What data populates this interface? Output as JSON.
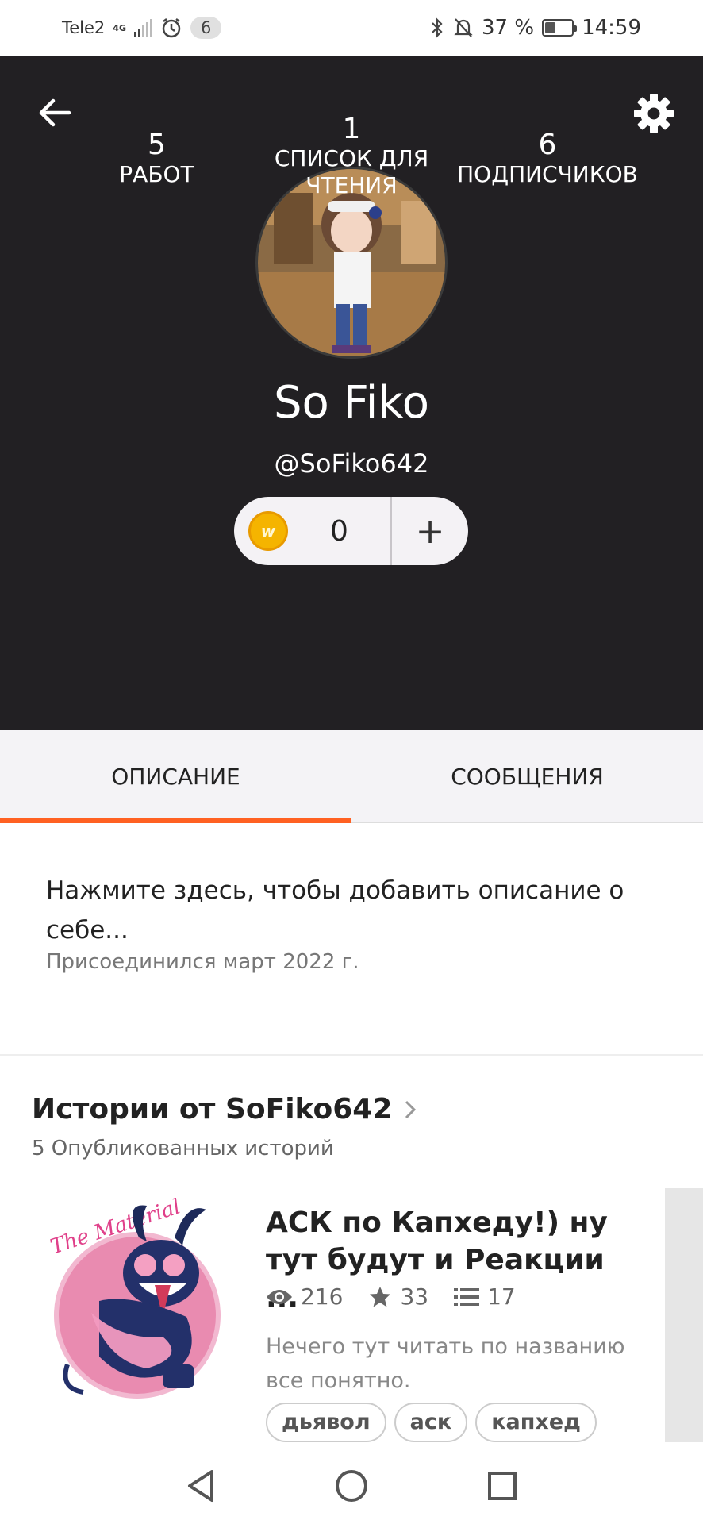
{
  "status_bar": {
    "carrier": "Tele2",
    "network": "4G",
    "notification_count": "6",
    "battery": "37 %",
    "time": "14:59",
    "icons": [
      "signal-icon",
      "alarm-icon",
      "bluetooth-icon",
      "mute-icon",
      "battery-icon"
    ]
  },
  "header": {
    "back_icon": "arrow-left-icon",
    "settings_icon": "gear-icon",
    "display_name": "So Fiko",
    "username": "@SoFiko642",
    "coins": {
      "count": "0",
      "add_label": "+"
    },
    "stats": {
      "works_count": "5",
      "works_label": "РАБОТ",
      "reading_count": "1",
      "reading_label_1": "СПИСОК ДЛЯ",
      "reading_label_2": "ЧТЕНИЯ",
      "followers_count": "6",
      "followers_label": "ПОДПИСЧИКОВ"
    }
  },
  "tabs": [
    {
      "label": "ОПИСАНИЕ",
      "active": true
    },
    {
      "label": "СООБЩЕНИЯ",
      "active": false
    }
  ],
  "about": {
    "prompt": "Нажмите здесь, чтобы добавить описание о себе...",
    "joined": "Присоединился март 2022 г."
  },
  "stories": {
    "title": "Истории от SoFiko642",
    "subtitle": "5 Опубликованных историй",
    "items": [
      {
        "title": "АСК по Капхеду!) ну тут будут и Реакции ...",
        "views": "216",
        "votes": "33",
        "parts": "17",
        "description": "Нечего тут читать по названию все понятно.",
        "tags": [
          "дьявол",
          "аск",
          "капхед"
        ]
      }
    ]
  },
  "colors": {
    "header_bg": "#222023",
    "accent": "#ff6122",
    "coin": "#f5b400"
  }
}
